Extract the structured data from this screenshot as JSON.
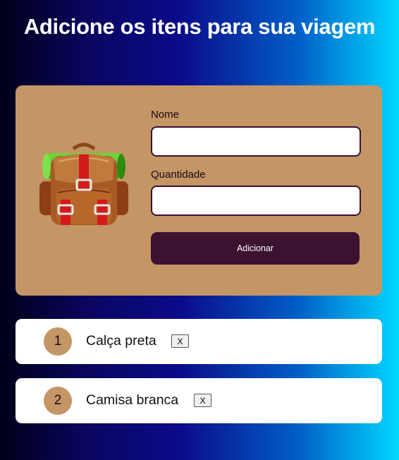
{
  "page": {
    "title": "Adicione os itens para sua viagem"
  },
  "form": {
    "image_icon": "backpack-icon",
    "name_label": "Nome",
    "name_value": "",
    "quantity_label": "Quantidade",
    "quantity_value": "",
    "submit_label": "Adicionar"
  },
  "items": [
    {
      "quantity": "1",
      "name": "Calça preta",
      "remove_label": "X"
    },
    {
      "quantity": "2",
      "name": "Camisa branca",
      "remove_label": "X"
    }
  ],
  "colors": {
    "card": "#c49565",
    "button": "#3b1230",
    "input_border": "#3b1230",
    "gradient_start": "#000018",
    "gradient_end": "#00d8ff"
  }
}
